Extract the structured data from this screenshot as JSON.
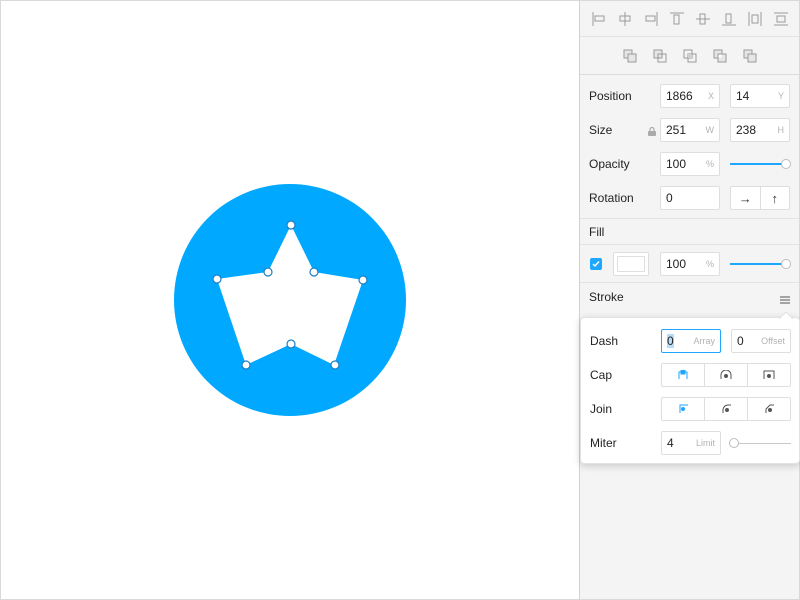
{
  "colors": {
    "accent": "#00a9ff",
    "slider": "#1ea7fd"
  },
  "align_tools": [
    "align-left-icon",
    "align-center-h-icon",
    "align-right-icon",
    "align-top-icon",
    "align-middle-v-icon",
    "align-bottom-icon",
    "distribute-h-icon",
    "distribute-v-icon"
  ],
  "boolean_tools": [
    "union-icon",
    "subtract-icon",
    "intersect-icon",
    "difference-icon",
    "flatten-icon"
  ],
  "position": {
    "label": "Position",
    "x": "1866",
    "x_unit": "X",
    "y": "14",
    "y_unit": "Y"
  },
  "size": {
    "label": "Size",
    "w": "251",
    "w_unit": "W",
    "h": "238",
    "h_unit": "H"
  },
  "opacity": {
    "label": "Opacity",
    "value": "100",
    "unit": "%",
    "level": 1.0
  },
  "rotation": {
    "label": "Rotation",
    "value": "0",
    "flip_h": "→",
    "flip_v": "↑"
  },
  "fill": {
    "title": "Fill",
    "enabled": true,
    "color": "#ffffff",
    "opacity": "100",
    "unit": "%",
    "level": 1.0
  },
  "stroke": {
    "title": "Stroke",
    "dash": {
      "label": "Dash",
      "array": "0",
      "array_placeholder": "Array",
      "offset": "0",
      "offset_placeholder": "Offset"
    },
    "cap": {
      "label": "Cap",
      "selected": 0,
      "options": [
        "butt-cap-icon",
        "round-cap-icon",
        "square-cap-icon"
      ]
    },
    "join": {
      "label": "Join",
      "selected": 0,
      "options": [
        "miter-join-icon",
        "round-join-icon",
        "bevel-join-icon"
      ]
    },
    "miter": {
      "label": "Miter",
      "value": "4",
      "unit": "Limit",
      "level": 0.05
    }
  }
}
